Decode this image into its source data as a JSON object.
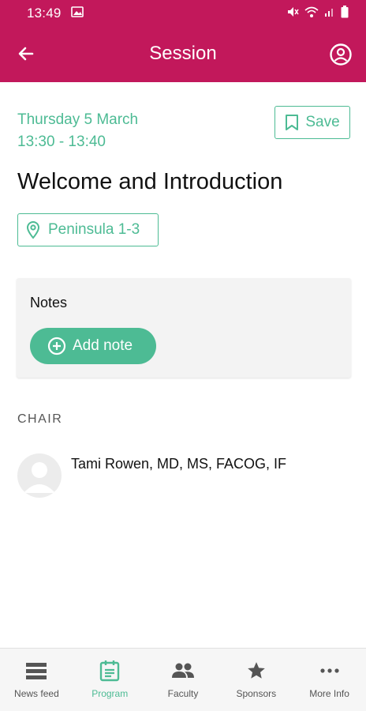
{
  "status_bar": {
    "time": "13:49"
  },
  "app_bar": {
    "title": "Session"
  },
  "session": {
    "date": "Thursday 5 March",
    "time_range": "13:30 - 13:40",
    "title": "Welcome and Introduction",
    "location": "Peninsula 1-3",
    "save_label": "Save"
  },
  "notes": {
    "label": "Notes",
    "add_button": "Add note"
  },
  "chair": {
    "heading": "CHAIR",
    "name": "Tami Rowen, MD, MS, FACOG, IF"
  },
  "bottom_nav": {
    "items": [
      {
        "label": "News feed",
        "icon": "news-feed-icon"
      },
      {
        "label": "Program",
        "icon": "program-icon",
        "active": true
      },
      {
        "label": "Faculty",
        "icon": "faculty-icon"
      },
      {
        "label": "Sponsors",
        "icon": "star-icon"
      },
      {
        "label": "More Info",
        "icon": "more-icon"
      }
    ]
  },
  "colors": {
    "primary": "#c2185b",
    "accent": "#4dbb94",
    "card_bg": "#f3f3f3",
    "nav_bg": "#f6f6f6"
  }
}
